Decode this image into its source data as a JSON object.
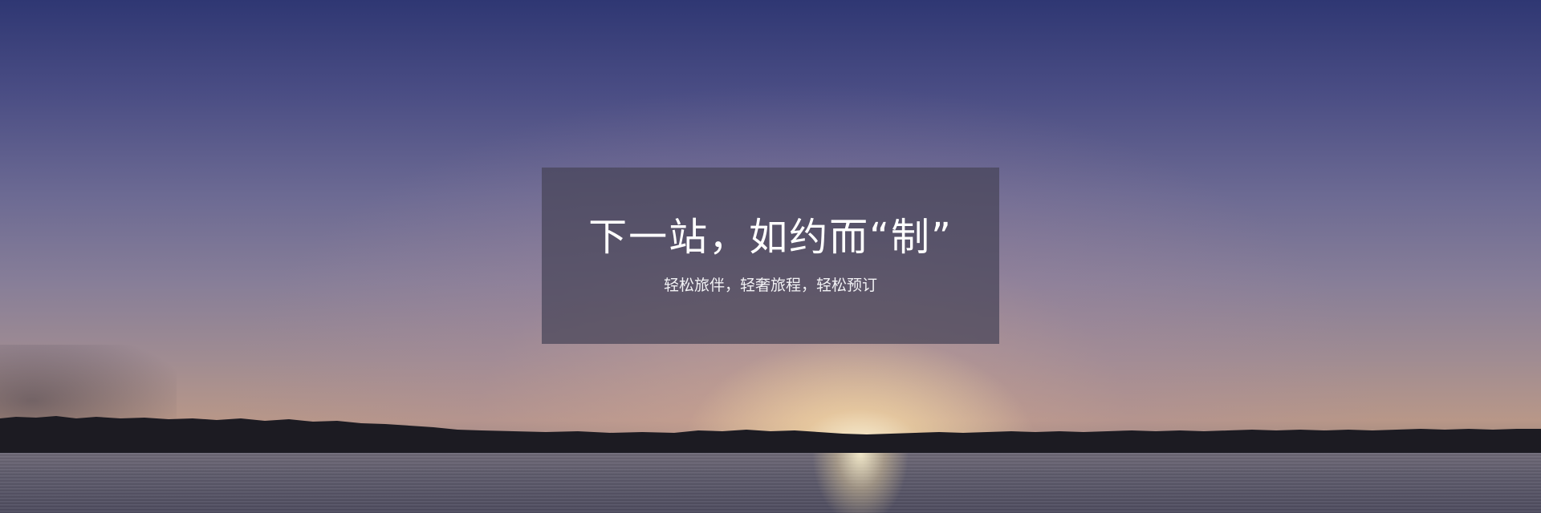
{
  "hero": {
    "title": "下一站，如约而“制”",
    "subtitle": "轻松旅伴，轻奢旅程，轻松预订",
    "background_image": "lake-sunset-photo"
  }
}
